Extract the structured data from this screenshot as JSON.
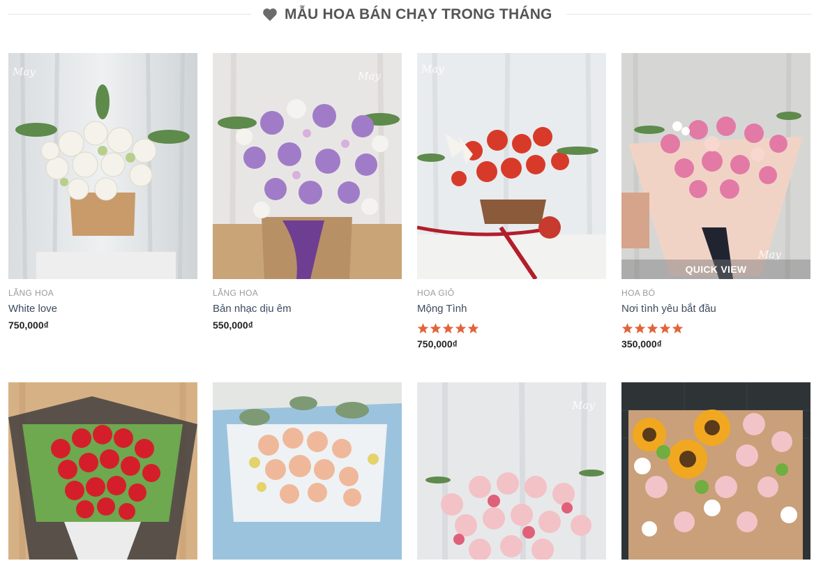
{
  "section": {
    "title": "MẪU HOA BÁN CHẠY TRONG THÁNG",
    "icon": "heart-icon",
    "accent": "#555555"
  },
  "products": [
    {
      "category": "LẴNG HOA",
      "name": "White love",
      "price": "750,000₫",
      "rating": null
    },
    {
      "category": "LẴNG HOA",
      "name": "Bản nhạc dịu êm",
      "price": "550,000₫",
      "rating": null
    },
    {
      "category": "HOA GIỎ",
      "name": "Mộng Tình",
      "price": "750,000₫",
      "rating": 5
    },
    {
      "category": "HOA BÓ",
      "name": "Nơi tình yêu bắt đầu",
      "price": "350,000₫",
      "rating": 5,
      "quick_view": "QUICK VIEW"
    }
  ],
  "star_color": "#e2643a",
  "watermark": "May"
}
